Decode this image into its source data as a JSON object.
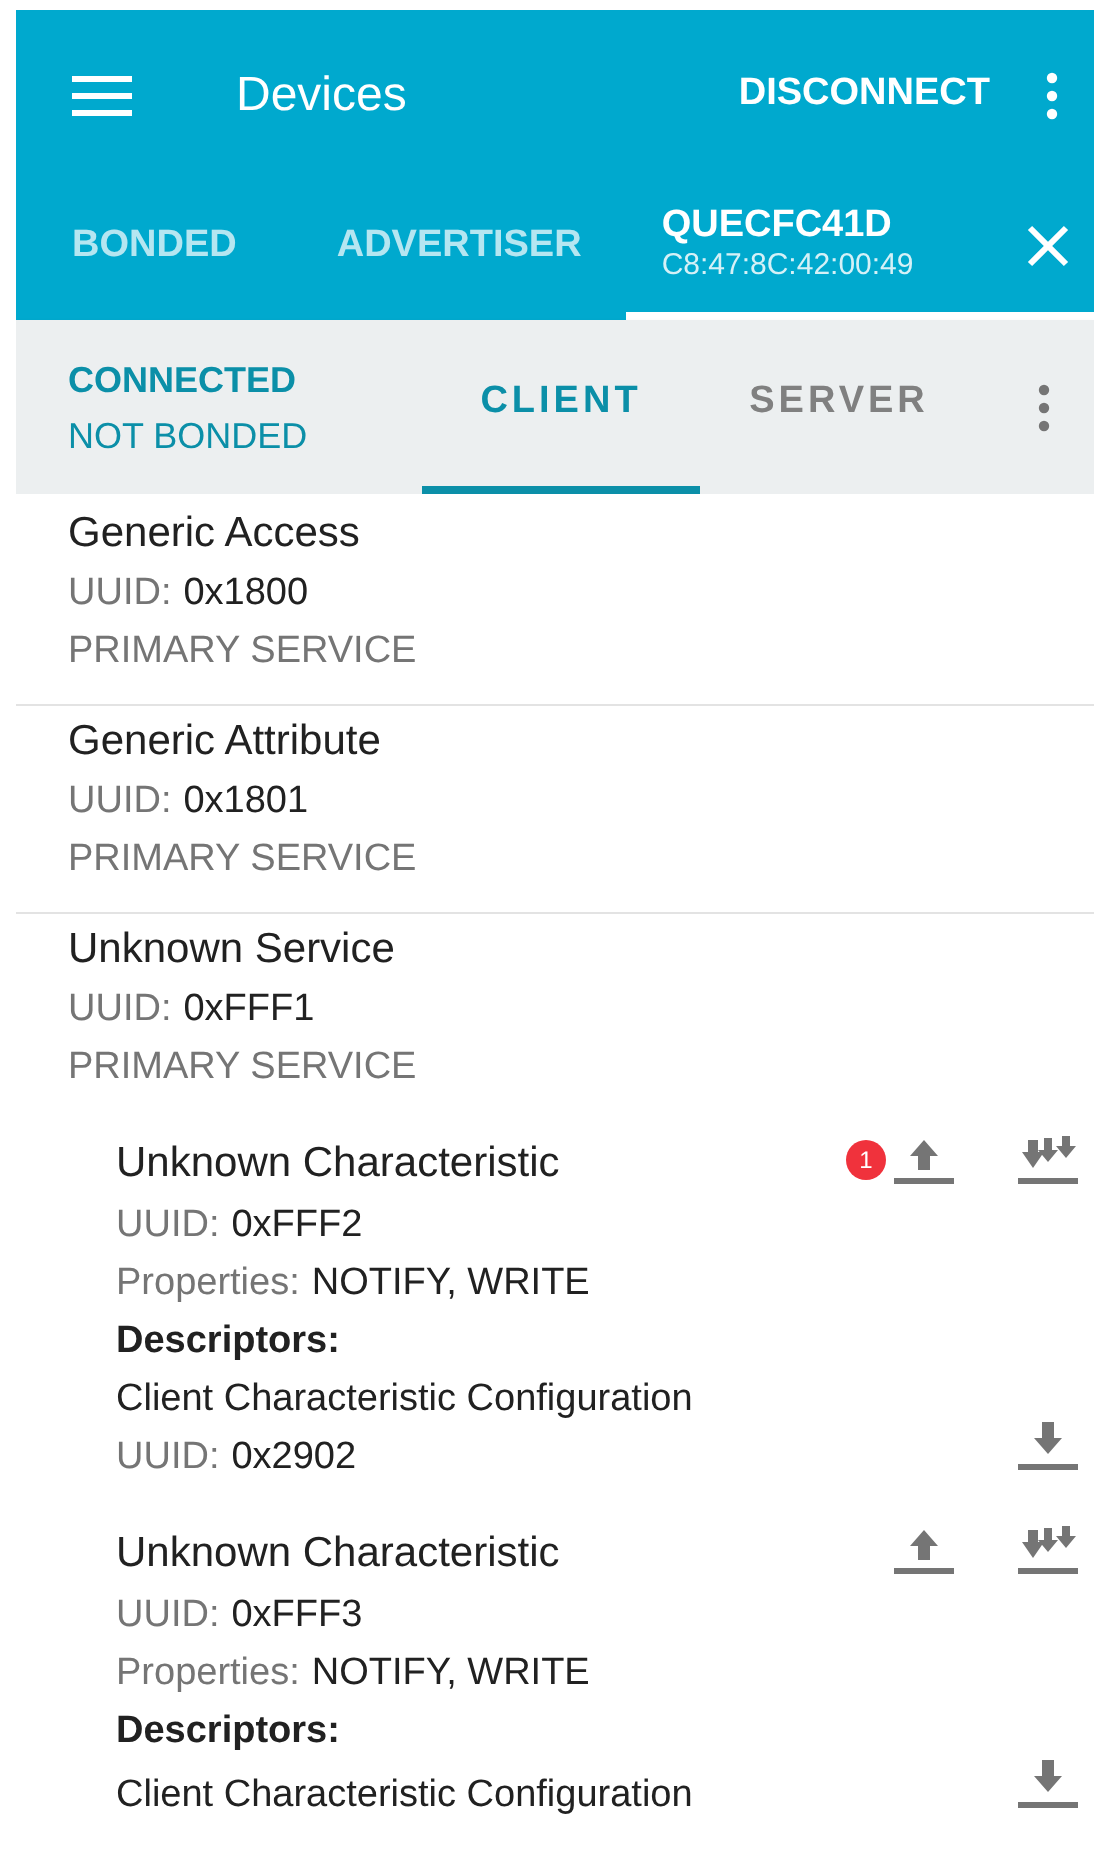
{
  "app_bar": {
    "title": "Devices",
    "action": "DISCONNECT"
  },
  "device_tabs": [
    {
      "label": "BONDED",
      "selected": false
    },
    {
      "label": "ADVERTISER",
      "selected": false
    },
    {
      "label": "QUECFC41D",
      "subtitle": "C8:47:8C:42:00:49",
      "selected": true
    }
  ],
  "status": {
    "connection": "CONNECTED",
    "bond": "NOT BONDED"
  },
  "mode_tabs": [
    {
      "label": "CLIENT",
      "selected": true
    },
    {
      "label": "SERVER",
      "selected": false
    }
  ],
  "services": [
    {
      "name": "Generic Access",
      "uuid_label": "UUID:",
      "uuid": "0x1800",
      "type": "PRIMARY SERVICE"
    },
    {
      "name": "Generic Attribute",
      "uuid_label": "UUID:",
      "uuid": "0x1801",
      "type": "PRIMARY SERVICE"
    },
    {
      "name": "Unknown Service",
      "uuid_label": "UUID:",
      "uuid": "0xFFF1",
      "type": "PRIMARY SERVICE",
      "characteristics": [
        {
          "name": "Unknown Characteristic",
          "badge": "1",
          "uuid_label": "UUID:",
          "uuid": "0xFFF2",
          "properties_label": "Properties:",
          "properties": "NOTIFY, WRITE",
          "descriptors_label": "Descriptors:",
          "descriptors": [
            {
              "name": "Client Characteristic Configuration",
              "uuid_label": "UUID:",
              "uuid": "0x2902"
            }
          ]
        },
        {
          "name": "Unknown Characteristic",
          "uuid_label": "UUID:",
          "uuid": "0xFFF3",
          "properties_label": "Properties:",
          "properties": "NOTIFY, WRITE",
          "descriptors_label": "Descriptors:",
          "descriptors": [
            {
              "name": "Client Characteristic Configuration"
            }
          ]
        }
      ]
    }
  ]
}
